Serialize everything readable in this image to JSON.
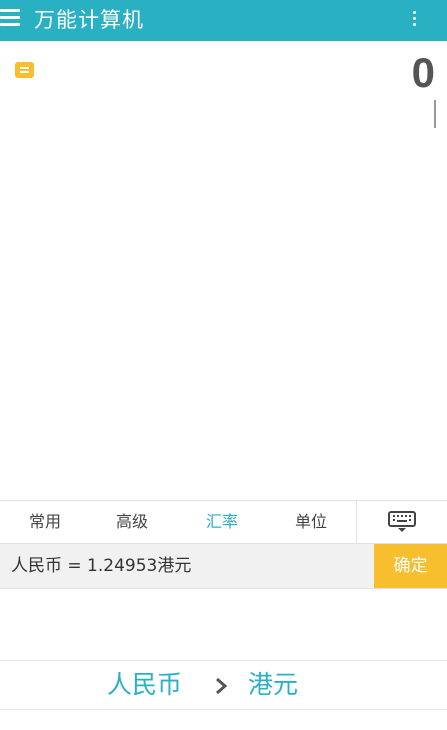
{
  "app_bar": {
    "title": "万能计算机",
    "menu_icon": "hamburger-menu-icon",
    "overflow_icon": "more-vertical-icon",
    "background_color": "#29b0c3"
  },
  "display": {
    "history_icon": "notes-icon",
    "value": "0"
  },
  "tabs": [
    {
      "label": "常用",
      "active": false
    },
    {
      "label": "高级",
      "active": false
    },
    {
      "label": "汇率",
      "active": true
    },
    {
      "label": "单位",
      "active": false
    }
  ],
  "keyboard_icon": "keyboard-icon",
  "rate": {
    "text": "人民币 = 1.24953港元",
    "confirm_label": "确定",
    "confirm_color": "#f7be2e"
  },
  "conversion": {
    "from": "人民币",
    "to": "港元",
    "arrow_icon": "chevron-right-icon"
  }
}
